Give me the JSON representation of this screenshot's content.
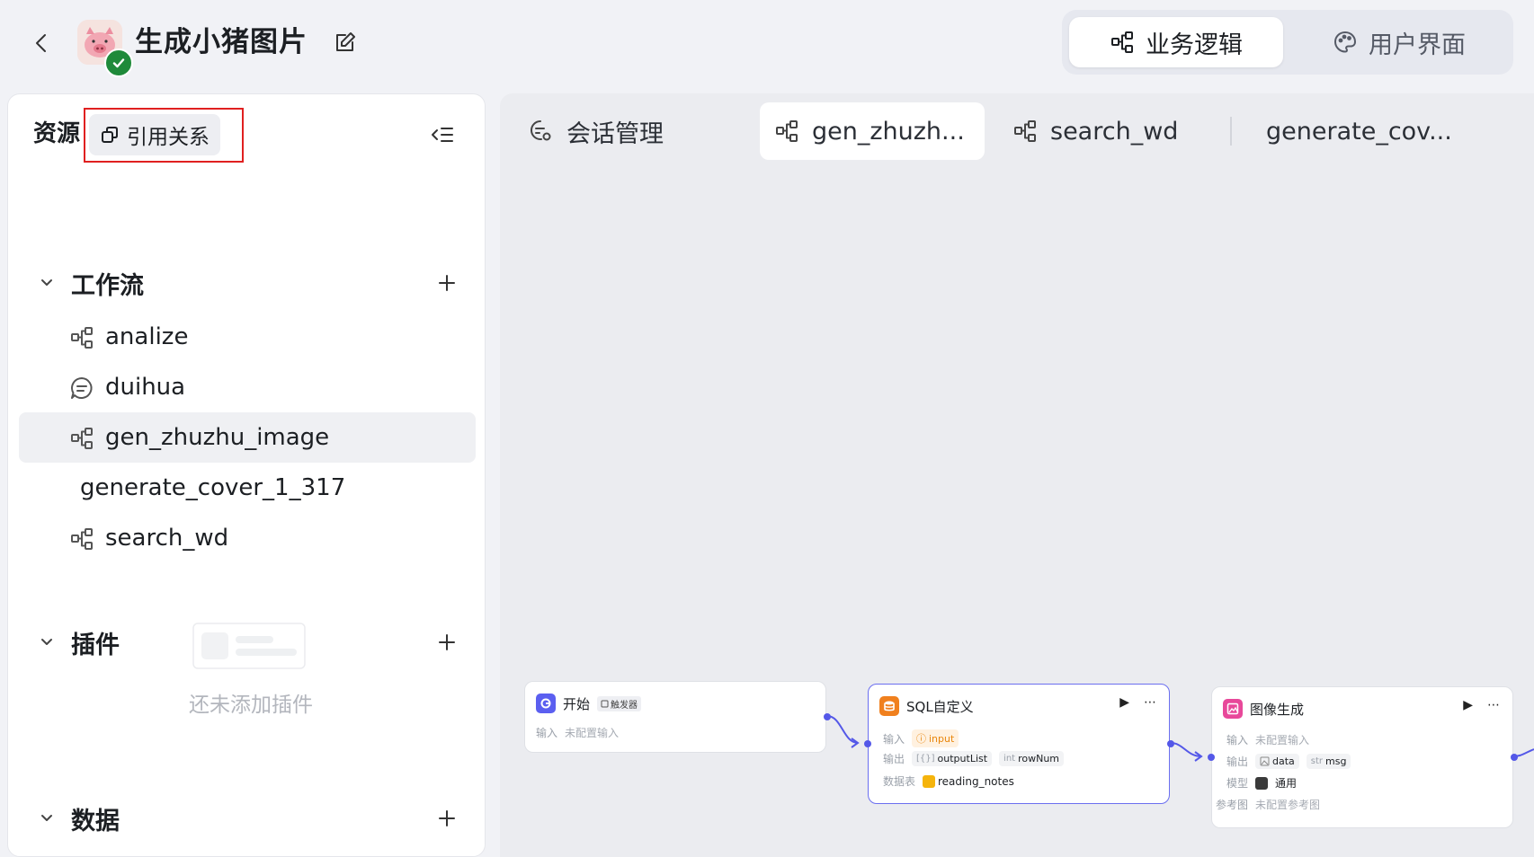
{
  "header": {
    "title": "生成小猪图片",
    "mode_tabs": [
      {
        "label": "业务逻辑",
        "icon": "workflow-icon",
        "active": true
      },
      {
        "label": "用户界面",
        "icon": "palette-icon",
        "active": false
      }
    ]
  },
  "sidebar": {
    "title": "资源",
    "ref_button_label": "引用关系",
    "sections": {
      "workflow": {
        "label": "工作流",
        "items": [
          {
            "label": "analize",
            "icon": "workflow-icon"
          },
          {
            "label": "duihua",
            "icon": "chat-icon"
          },
          {
            "label": "gen_zhuzhu_image",
            "icon": "workflow-icon",
            "selected": true
          },
          {
            "label": "generate_cover_1_317",
            "icon": ""
          },
          {
            "label": "search_wd",
            "icon": "workflow-icon"
          }
        ]
      },
      "plugins": {
        "label": "插件",
        "empty_text": "还未添加插件"
      },
      "data": {
        "label": "数据"
      }
    }
  },
  "tabs": [
    {
      "label": "会话管理",
      "icon": "chat-settings-icon",
      "active": false
    },
    {
      "label": "gen_zhuzh...",
      "icon": "workflow-icon",
      "active": true
    },
    {
      "label": "search_wd",
      "icon": "workflow-icon",
      "active": false
    },
    {
      "label": "generate_cov...",
      "icon": "",
      "active": false
    }
  ],
  "nodes": {
    "start": {
      "title": "开始",
      "badge": "触发器",
      "input_key": "输入",
      "input_value": "未配置输入"
    },
    "sql": {
      "title": "SQL自定义",
      "input_key": "输入",
      "input_chip": "input",
      "output_key": "输出",
      "output_chips": [
        {
          "type": "[{}]",
          "name": "outputList"
        },
        {
          "type": "int",
          "name": "rowNum"
        }
      ],
      "table_key": "数据表",
      "table_value": "reading_notes"
    },
    "image": {
      "title": "图像生成",
      "input_key": "输入",
      "input_value": "未配置输入",
      "output_key": "输出",
      "output_chips": [
        {
          "type": "img",
          "name": "data"
        },
        {
          "type": "str",
          "name": "msg"
        }
      ],
      "model_key": "模型",
      "model_value": "通用",
      "ref_key": "参考图",
      "ref_value": "未配置参考图"
    }
  },
  "colors": {
    "accent": "#5458e8",
    "highlight_box": "#e02020",
    "verified": "#1f8a3a",
    "sql_icon": "#f0801e",
    "image_icon": "#e8489a",
    "start_icon": "#5b5ff0"
  }
}
